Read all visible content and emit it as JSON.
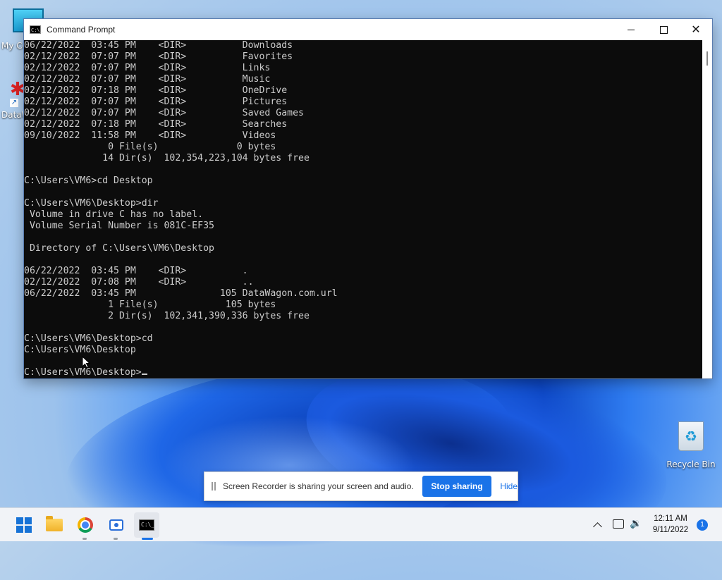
{
  "desktop": {
    "icons": [
      {
        "label": "My Co"
      },
      {
        "label": "DataW"
      },
      {
        "label": "Recycle Bin"
      }
    ]
  },
  "window": {
    "title": "Command Prompt",
    "icon_text": "C:\\_",
    "minimize_icon": "minimize-icon",
    "maximize_icon": "maximize-icon",
    "close_glyph": "✕"
  },
  "console": {
    "lines": [
      "06/22/2022  03:45 PM    <DIR>          Downloads",
      "02/12/2022  07:07 PM    <DIR>          Favorites",
      "02/12/2022  07:07 PM    <DIR>          Links",
      "02/12/2022  07:07 PM    <DIR>          Music",
      "02/12/2022  07:18 PM    <DIR>          OneDrive",
      "02/12/2022  07:07 PM    <DIR>          Pictures",
      "02/12/2022  07:07 PM    <DIR>          Saved Games",
      "02/12/2022  07:18 PM    <DIR>          Searches",
      "09/10/2022  11:58 PM    <DIR>          Videos",
      "               0 File(s)              0 bytes",
      "              14 Dir(s)  102,354,223,104 bytes free",
      "",
      "C:\\Users\\VM6>cd Desktop",
      "",
      "C:\\Users\\VM6\\Desktop>dir",
      " Volume in drive C has no label.",
      " Volume Serial Number is 081C-EF35",
      "",
      " Directory of C:\\Users\\VM6\\Desktop",
      "",
      "06/22/2022  03:45 PM    <DIR>          .",
      "02/12/2022  07:08 PM    <DIR>          ..",
      "06/22/2022  03:45 PM               105 DataWagon.com.url",
      "               1 File(s)            105 bytes",
      "               2 Dir(s)  102,341,390,336 bytes free",
      "",
      "C:\\Users\\VM6\\Desktop>cd",
      "C:\\Users\\VM6\\Desktop",
      ""
    ],
    "prompt": "C:\\Users\\VM6\\Desktop>"
  },
  "recorder": {
    "message": "Screen Recorder is sharing your screen and audio.",
    "stop_label": "Stop sharing",
    "hide_label": "Hide"
  },
  "taskbar": {
    "apps": [
      "start",
      "file-explorer",
      "chrome",
      "camera",
      "command-prompt"
    ],
    "cmd_icon_text": "C:\\_",
    "clock_time": "12:11 AM",
    "clock_date": "9/11/2022",
    "notification_count": "1",
    "accent_color": "#1a73e8"
  }
}
